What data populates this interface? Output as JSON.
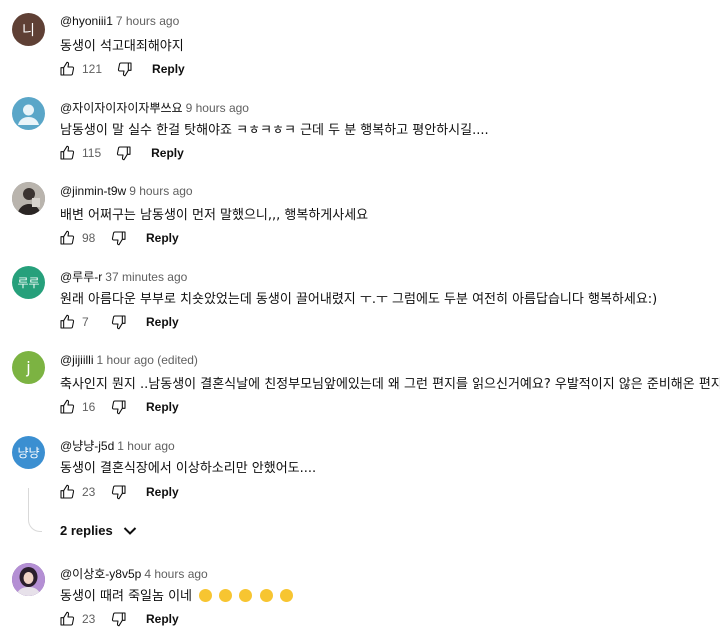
{
  "comments": [
    {
      "avatar_text": "니",
      "avatar_color": "#5f4035",
      "author": "@hyoniii1",
      "time": "7 hours ago",
      "text": "동생이 석고대죄해야지",
      "likes": "121",
      "reply_label": "Reply"
    },
    {
      "avatar_text": "",
      "avatar_color": "#5aa6c8",
      "author": "@자이자이자이자뿌쓰요",
      "time": "9 hours ago",
      "text": "남동생이 말 실수 한걸 탓해야죠 ㅋㅎㅋㅎㅋ 근데 두 분 행복하고 평안하시길....",
      "likes": "115",
      "reply_label": "Reply"
    },
    {
      "avatar_text": "",
      "avatar_color": "#8a8a8a",
      "author": "@jinmin-t9w",
      "time": "9 hours ago",
      "text": "배변 어쩌구는 남동생이 먼저 말했으니,,, 행복하게사세요",
      "likes": "98",
      "reply_label": "Reply"
    },
    {
      "avatar_text": "루루",
      "avatar_color": "#26a07b",
      "author": "@루루-r",
      "time": "37 minutes ago",
      "text": "원래 아름다운 부부로 치숏았었는데 동생이 끌어내렸지 ㅜ.ㅜ 그럼에도 두분 여전히 아름답습니다 행복하세요:)",
      "likes": "7",
      "reply_label": "Reply"
    },
    {
      "avatar_text": "j",
      "avatar_color": "#7cb342",
      "author": "@jijiilli",
      "time": "1 hour ago (edited)",
      "text": "축사인지 뭔지 ..남동생이 결혼식날에 친정부모님앞에있는데 왜 그런 편지를 읽으신거예요? 우발적이지 않은 준비해온 편지요",
      "likes": "16",
      "reply_label": "Reply"
    },
    {
      "avatar_text": "냥냥",
      "avatar_color": "#3b8fd1",
      "author": "@냥냥-j5d",
      "time": "1 hour ago",
      "text": "동생이 결혼식장에서 이상하소리만 안했어도....",
      "likes": "23",
      "reply_label": "Reply",
      "replies_label": "2 replies"
    },
    {
      "avatar_text": "",
      "avatar_color": "#6b4b8a",
      "author": "@이상호-y8v5p",
      "time": "4 hours ago",
      "text": "동생이 때려 죽일놈 이네",
      "likes": "23",
      "reply_label": "Reply"
    }
  ]
}
